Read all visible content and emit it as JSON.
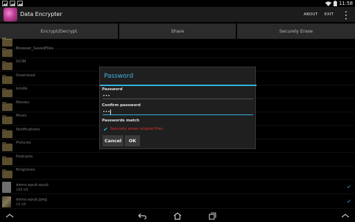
{
  "status_bar": {
    "time": "11:58",
    "left_icons": [
      "image-icon",
      "image-icon",
      "image-icon"
    ],
    "right_icons": [
      "wifi-icon",
      "battery-icon"
    ]
  },
  "action_bar": {
    "app_title": "Data Encrypter",
    "about_label": "ABOUT",
    "exit_label": "EXIT",
    "overflow_icon": "overflow-menu-icon"
  },
  "top_buttons": {
    "encrypt_decrypt": "Encrypt/Decrypt",
    "share": "Share",
    "securely_erase": "Securely Erase"
  },
  "files": [
    {
      "name": "",
      "type": "folder",
      "checked": false
    },
    {
      "name": "Browser_SavedFiles",
      "type": "folder",
      "checked": false
    },
    {
      "name": "DCIM",
      "type": "folder",
      "checked": false
    },
    {
      "name": "Download",
      "type": "folder",
      "checked": false
    },
    {
      "name": "kindle",
      "type": "folder",
      "checked": false
    },
    {
      "name": "Movies",
      "type": "folder",
      "checked": false
    },
    {
      "name": "Music",
      "type": "folder",
      "checked": false
    },
    {
      "name": "Notifications",
      "type": "folder",
      "checked": false
    },
    {
      "name": "Pictures",
      "type": "folder",
      "checked": false
    },
    {
      "name": "Podcasts",
      "type": "folder",
      "checked": false
    },
    {
      "name": "Ringtones",
      "type": "folder",
      "checked": false
    },
    {
      "name": "demo.epub.epub",
      "size": "186 kB",
      "type": "file",
      "checked": true
    },
    {
      "name": "demo.epub.jpeg",
      "size": "16 kB",
      "type": "image",
      "checked": true
    }
  ],
  "dialog": {
    "title": "Password",
    "password_label": "Password",
    "password_value": "•••",
    "confirm_label": "Confirm password",
    "confirm_value": "•••",
    "match_status": "Passwords match",
    "erase_checkbox_label": "Securely erase original files",
    "erase_checked": true,
    "cancel_label": "Cancel",
    "ok_label": "OK"
  },
  "colors": {
    "accent": "#33b5e5",
    "warning_text": "#e3312b",
    "folder": "#8b7849"
  },
  "nav_bar": {
    "items": [
      "up-chevron-icon",
      "back-icon",
      "home-icon",
      "recent-apps-icon",
      "up-chevron-icon"
    ]
  }
}
